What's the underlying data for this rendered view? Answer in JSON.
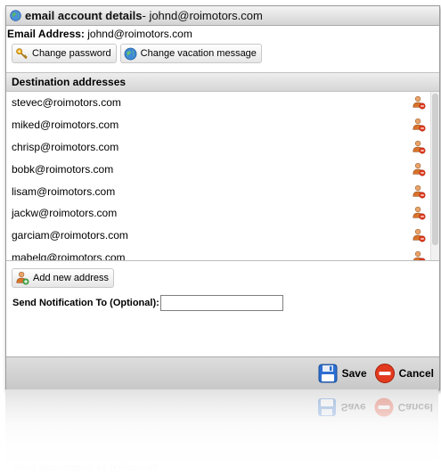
{
  "window": {
    "title_prefix": "email account details",
    "title_suffix": " - johnd@roimotors.com"
  },
  "email_address": {
    "label": "Email Address:",
    "value": " johnd@roimotors.com"
  },
  "toolbar": {
    "change_password": "Change password",
    "change_vacation": "Change vacation message"
  },
  "destinations": {
    "header": "Destination addresses",
    "items": [
      {
        "address": "stevec@roimotors.com"
      },
      {
        "address": "miked@roimotors.com"
      },
      {
        "address": "chrisp@roimotors.com"
      },
      {
        "address": "bobk@roimotors.com"
      },
      {
        "address": "lisam@roimotors.com"
      },
      {
        "address": "jackw@roimotors.com"
      },
      {
        "address": "garciam@roimotors.com"
      },
      {
        "address": "mabelg@roimotors.com"
      }
    ]
  },
  "add_address": {
    "label": "Add new address"
  },
  "notification": {
    "label": "Send Notification To (Optional):",
    "value": "",
    "placeholder": ""
  },
  "footer": {
    "save": "Save",
    "cancel": "Cancel"
  },
  "icons": {
    "title": "globe-icon",
    "change_password": "key-icon",
    "change_vacation": "globe-icon",
    "remove_address": "user-remove-icon",
    "add_address": "user-add-icon",
    "save": "floppy-disk-icon",
    "cancel": "no-entry-icon"
  },
  "colors": {
    "save_blue": "#2d6fd1",
    "cancel_red": "#e23a1e",
    "user_icon_orange": "#d9732a"
  }
}
